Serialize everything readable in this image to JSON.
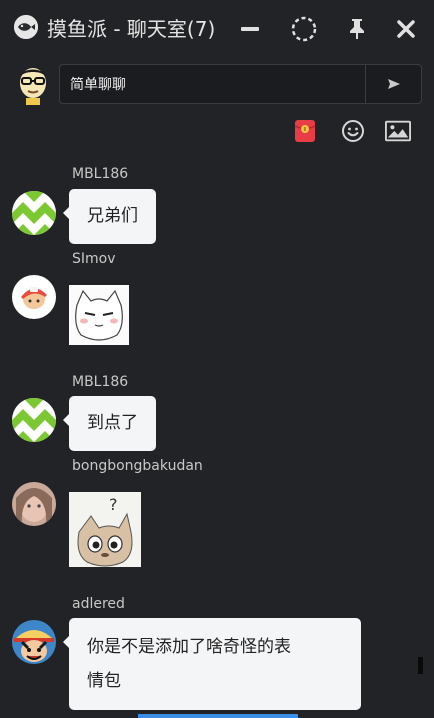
{
  "window": {
    "title": "摸鱼派 - 聊天室(7)",
    "logo_icon": "fish-logo-icon",
    "controls": [
      "minimize-icon",
      "loop-icon",
      "pin-icon",
      "close-icon"
    ]
  },
  "composer": {
    "input_value": "简单聊聊",
    "send_icon": "send-icon"
  },
  "toolbar": {
    "icons": [
      "red-packet-icon",
      "emoji-icon",
      "image-icon"
    ],
    "red_packet_color": "#e83c46"
  },
  "messages": [
    {
      "user": "MBL186",
      "type": "text",
      "text": "兄弟们"
    },
    {
      "user": "SImov",
      "type": "sticker",
      "sticker": "cat-sticker"
    },
    {
      "user": "MBL186",
      "type": "text",
      "text": "到点了"
    },
    {
      "user": "bongbongbakudan",
      "type": "sticker",
      "sticker": "confused-cat-sticker"
    },
    {
      "user": "adlered",
      "type": "text",
      "text": "你是不是添加了啥奇怪的表情包"
    }
  ],
  "msg4_line1": "你是不是添加了啥奇怪的表",
  "msg4_line2": "情包",
  "colors": {
    "background": "#222326",
    "bubble": "#f4f5f7",
    "accent": "#3a8ee6"
  }
}
